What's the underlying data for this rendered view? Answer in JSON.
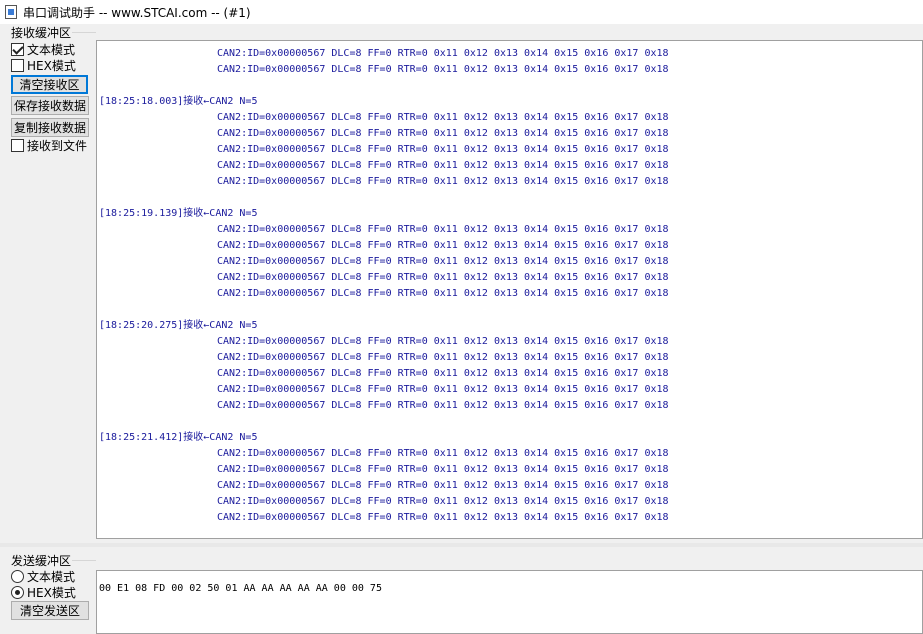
{
  "window": {
    "title": "串口调试助手 -- www.STCAI.com -- (#1)"
  },
  "receive": {
    "group_label": "接收缓冲区",
    "text_mode_label": "文本模式",
    "text_mode_checked": true,
    "hex_mode_label": "HEX模式",
    "hex_mode_checked": false,
    "clear_button": "清空接收区",
    "save_button": "保存接收数据",
    "copy_button": "复制接收数据",
    "to_file_label": "接收到文件",
    "to_file_checked": false,
    "lines": [
      {
        "text": "CAN2:ID=0x00000567 DLC=8 FF=0 RTR=0 0x11 0x12 0x13 0x14 0x15 0x16 0x17 0x18",
        "indent": true
      },
      {
        "text": "CAN2:ID=0x00000567 DLC=8 FF=0 RTR=0 0x11 0x12 0x13 0x14 0x15 0x16 0x17 0x18",
        "indent": true
      },
      {
        "text": "",
        "indent": false
      },
      {
        "text": "[18:25:18.003]接收←CAN2 N=5",
        "indent": false
      },
      {
        "text": "CAN2:ID=0x00000567 DLC=8 FF=0 RTR=0 0x11 0x12 0x13 0x14 0x15 0x16 0x17 0x18",
        "indent": true
      },
      {
        "text": "CAN2:ID=0x00000567 DLC=8 FF=0 RTR=0 0x11 0x12 0x13 0x14 0x15 0x16 0x17 0x18",
        "indent": true
      },
      {
        "text": "CAN2:ID=0x00000567 DLC=8 FF=0 RTR=0 0x11 0x12 0x13 0x14 0x15 0x16 0x17 0x18",
        "indent": true
      },
      {
        "text": "CAN2:ID=0x00000567 DLC=8 FF=0 RTR=0 0x11 0x12 0x13 0x14 0x15 0x16 0x17 0x18",
        "indent": true
      },
      {
        "text": "CAN2:ID=0x00000567 DLC=8 FF=0 RTR=0 0x11 0x12 0x13 0x14 0x15 0x16 0x17 0x18",
        "indent": true
      },
      {
        "text": "",
        "indent": false
      },
      {
        "text": "[18:25:19.139]接收←CAN2 N=5",
        "indent": false
      },
      {
        "text": "CAN2:ID=0x00000567 DLC=8 FF=0 RTR=0 0x11 0x12 0x13 0x14 0x15 0x16 0x17 0x18",
        "indent": true
      },
      {
        "text": "CAN2:ID=0x00000567 DLC=8 FF=0 RTR=0 0x11 0x12 0x13 0x14 0x15 0x16 0x17 0x18",
        "indent": true
      },
      {
        "text": "CAN2:ID=0x00000567 DLC=8 FF=0 RTR=0 0x11 0x12 0x13 0x14 0x15 0x16 0x17 0x18",
        "indent": true
      },
      {
        "text": "CAN2:ID=0x00000567 DLC=8 FF=0 RTR=0 0x11 0x12 0x13 0x14 0x15 0x16 0x17 0x18",
        "indent": true
      },
      {
        "text": "CAN2:ID=0x00000567 DLC=8 FF=0 RTR=0 0x11 0x12 0x13 0x14 0x15 0x16 0x17 0x18",
        "indent": true
      },
      {
        "text": "",
        "indent": false
      },
      {
        "text": "[18:25:20.275]接收←CAN2 N=5",
        "indent": false
      },
      {
        "text": "CAN2:ID=0x00000567 DLC=8 FF=0 RTR=0 0x11 0x12 0x13 0x14 0x15 0x16 0x17 0x18",
        "indent": true
      },
      {
        "text": "CAN2:ID=0x00000567 DLC=8 FF=0 RTR=0 0x11 0x12 0x13 0x14 0x15 0x16 0x17 0x18",
        "indent": true
      },
      {
        "text": "CAN2:ID=0x00000567 DLC=8 FF=0 RTR=0 0x11 0x12 0x13 0x14 0x15 0x16 0x17 0x18",
        "indent": true
      },
      {
        "text": "CAN2:ID=0x00000567 DLC=8 FF=0 RTR=0 0x11 0x12 0x13 0x14 0x15 0x16 0x17 0x18",
        "indent": true
      },
      {
        "text": "CAN2:ID=0x00000567 DLC=8 FF=0 RTR=0 0x11 0x12 0x13 0x14 0x15 0x16 0x17 0x18",
        "indent": true
      },
      {
        "text": "",
        "indent": false
      },
      {
        "text": "[18:25:21.412]接收←CAN2 N=5",
        "indent": false
      },
      {
        "text": "CAN2:ID=0x00000567 DLC=8 FF=0 RTR=0 0x11 0x12 0x13 0x14 0x15 0x16 0x17 0x18",
        "indent": true
      },
      {
        "text": "CAN2:ID=0x00000567 DLC=8 FF=0 RTR=0 0x11 0x12 0x13 0x14 0x15 0x16 0x17 0x18",
        "indent": true
      },
      {
        "text": "CAN2:ID=0x00000567 DLC=8 FF=0 RTR=0 0x11 0x12 0x13 0x14 0x15 0x16 0x17 0x18",
        "indent": true
      },
      {
        "text": "CAN2:ID=0x00000567 DLC=8 FF=0 RTR=0 0x11 0x12 0x13 0x14 0x15 0x16 0x17 0x18",
        "indent": true
      },
      {
        "text": "CAN2:ID=0x00000567 DLC=8 FF=0 RTR=0 0x11 0x12 0x13 0x14 0x15 0x16 0x17 0x18",
        "indent": true
      }
    ]
  },
  "send": {
    "group_label": "发送缓冲区",
    "text_mode_label": "文本模式",
    "text_mode_selected": false,
    "hex_mode_label": "HEX模式",
    "hex_mode_selected": true,
    "clear_button": "清空发送区",
    "content": "00 E1 08 FD 00 02 50 01 AA AA AA AA AA 00 00 75"
  },
  "colors": {
    "receive_text": "#1a1a9c",
    "window_bg": "#f0f0f0",
    "focus_border": "#0078d7"
  }
}
